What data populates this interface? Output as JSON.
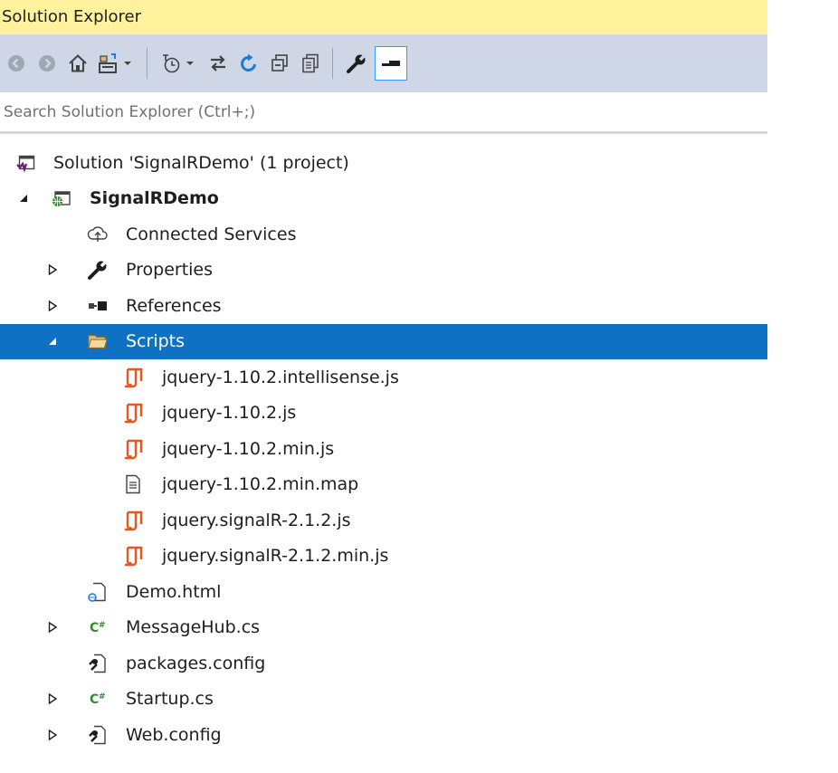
{
  "window": {
    "title": "Solution Explorer"
  },
  "toolbar": {
    "buttons": [
      {
        "icon": "back-icon"
      },
      {
        "icon": "forward-icon"
      },
      {
        "icon": "home-icon"
      },
      {
        "icon": "switch-views-icon"
      },
      {
        "icon": "dropdown-arrow-icon"
      },
      {
        "icon": "pending-changes-filter-icon"
      },
      {
        "icon": "dropdown-arrow-icon"
      },
      {
        "icon": "sync-with-active-document-icon"
      },
      {
        "icon": "refresh-icon"
      },
      {
        "icon": "collapse-all-icon"
      },
      {
        "icon": "show-all-files-icon"
      },
      {
        "icon": "properties-icon"
      },
      {
        "icon": "preview-selected-items-icon"
      }
    ]
  },
  "search": {
    "placeholder": "Search Solution Explorer (Ctrl+;)",
    "value": ""
  },
  "colors": {
    "title_bar": "#fff29d",
    "toolbar": "#cfd6e5",
    "selection": "#0e71c4",
    "js_icon": "#e8561f",
    "csharp_icon": "#388a34",
    "solution_icon": "#68217a"
  },
  "tree": {
    "items": [
      {
        "label": "Solution 'SignalRDemo' (1 project)",
        "icon": "solution-icon",
        "expander": ""
      },
      {
        "label": "SignalRDemo",
        "icon": "web-project-icon",
        "expander": "expanded",
        "bold": true
      },
      {
        "label": "Connected Services",
        "icon": "connected-services-icon",
        "expander": ""
      },
      {
        "label": "Properties",
        "icon": "wrench-icon",
        "expander": "collapsed"
      },
      {
        "label": "References",
        "icon": "references-icon",
        "expander": "collapsed"
      },
      {
        "label": "Scripts",
        "icon": "folder-open-icon",
        "expander": "expanded",
        "selected": true
      },
      {
        "label": "jquery-1.10.2.intellisense.js",
        "icon": "javascript-file-icon",
        "expander": ""
      },
      {
        "label": "jquery-1.10.2.js",
        "icon": "javascript-file-icon",
        "expander": ""
      },
      {
        "label": "jquery-1.10.2.min.js",
        "icon": "javascript-file-icon",
        "expander": ""
      },
      {
        "label": "jquery-1.10.2.min.map",
        "icon": "text-file-icon",
        "expander": ""
      },
      {
        "label": "jquery.signalR-2.1.2.js",
        "icon": "javascript-file-icon",
        "expander": ""
      },
      {
        "label": "jquery.signalR-2.1.2.min.js",
        "icon": "javascript-file-icon",
        "expander": ""
      },
      {
        "label": "Demo.html",
        "icon": "html-file-icon",
        "expander": ""
      },
      {
        "label": "MessageHub.cs",
        "icon": "csharp-file-icon",
        "expander": "collapsed"
      },
      {
        "label": "packages.config",
        "icon": "config-file-icon",
        "expander": ""
      },
      {
        "label": "Startup.cs",
        "icon": "csharp-file-icon",
        "expander": "collapsed"
      },
      {
        "label": "Web.config",
        "icon": "config-file-icon",
        "expander": "collapsed"
      }
    ]
  }
}
